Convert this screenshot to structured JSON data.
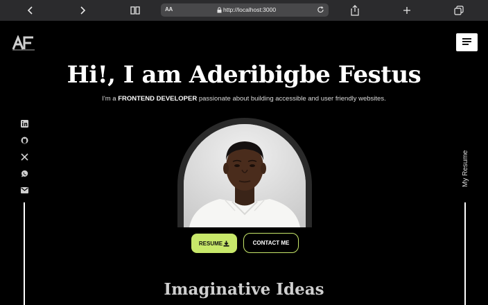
{
  "browser": {
    "aa_label": "AA",
    "url": "http://localhost:3000"
  },
  "header": {
    "logo_text": "AF"
  },
  "hero": {
    "title": "Hi!, I am Aderibigbe Festus",
    "subtitle_prefix": "I'm a ",
    "subtitle_role": "FRONTEND DEVELOPER",
    "subtitle_suffix": " passionate about building accessible and user friendly websites."
  },
  "socials": [
    {
      "icon": "linkedin-icon"
    },
    {
      "icon": "github-icon"
    },
    {
      "icon": "x-twitter-icon"
    },
    {
      "icon": "whatsapp-icon"
    },
    {
      "icon": "mail-icon"
    }
  ],
  "side": {
    "resume_label": "My Resume"
  },
  "actions": {
    "resume_label": "RESUME",
    "contact_label": "CONTACT ME"
  },
  "section": {
    "title": "Imaginative Ideas"
  },
  "colors": {
    "accent": "#c8e86a",
    "background": "#000000"
  }
}
